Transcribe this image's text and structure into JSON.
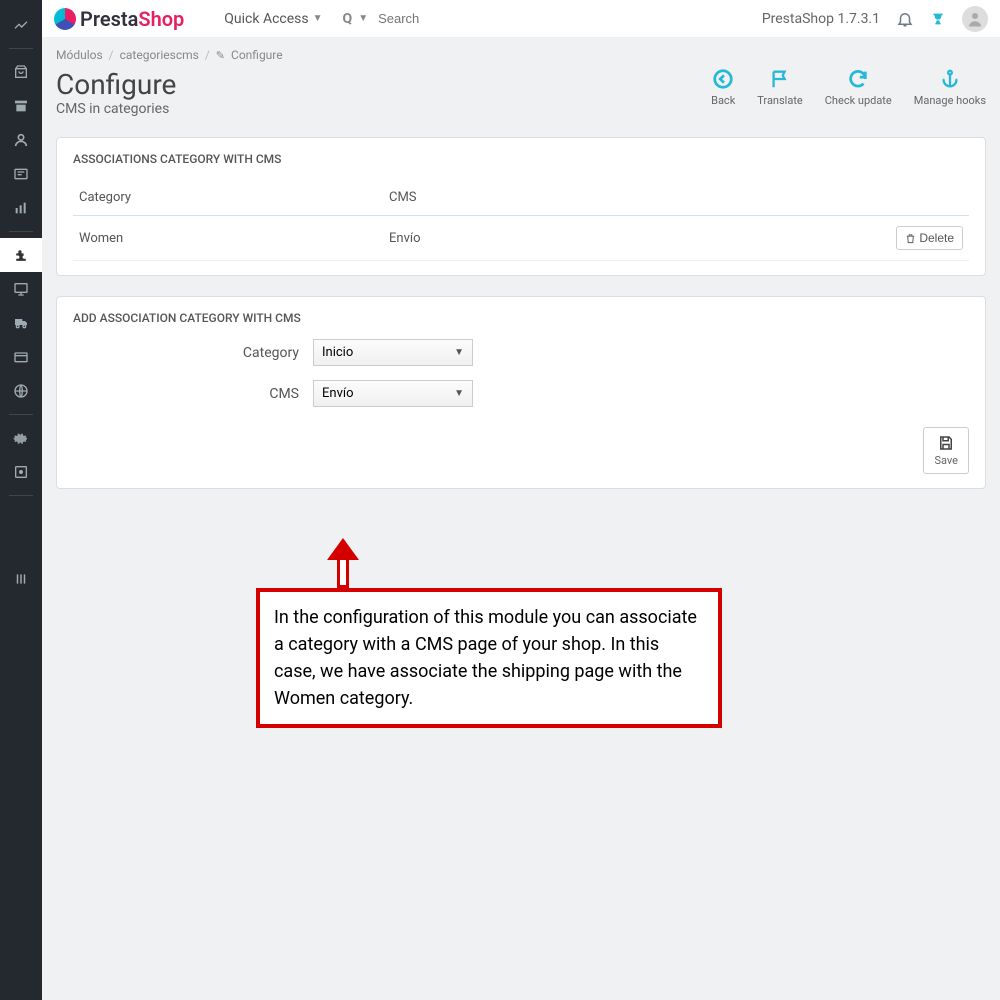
{
  "header": {
    "brand_presta": "Presta",
    "brand_shop": "Shop",
    "quick_access": "Quick Access",
    "search_placeholder": "Search",
    "version": "PrestaShop 1.7.3.1"
  },
  "breadcrumb": {
    "a": "Módulos",
    "b": "categoriescms",
    "c": "Configure"
  },
  "page": {
    "title": "Configure",
    "subtitle": "CMS in categories"
  },
  "toolbar": {
    "back": "Back",
    "translate": "Translate",
    "check": "Check update",
    "hooks": "Manage hooks"
  },
  "panel1": {
    "title": "ASSOCIATIONS CATEGORY WITH CMS",
    "col_cat": "Category",
    "col_cms": "CMS",
    "row_cat": "Women",
    "row_cms": "Envío",
    "delete": "Delete"
  },
  "panel2": {
    "title": "ADD ASSOCIATION CATEGORY WITH CMS",
    "label_cat": "Category",
    "value_cat": "Inicio",
    "label_cms": "CMS",
    "value_cms": "Envío",
    "save": "Save"
  },
  "annotation": "In the configuration of this module you can associate a category with a CMS page of your shop. In this case, we have associate the shipping page with the Women category."
}
